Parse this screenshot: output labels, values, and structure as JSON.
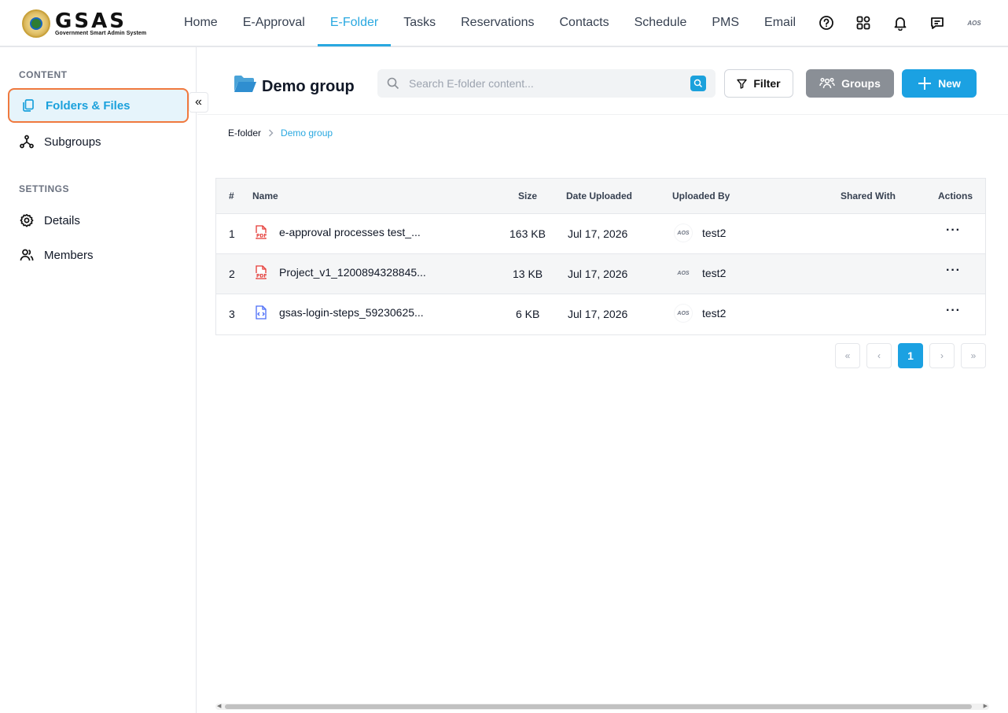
{
  "app": {
    "logo_title": "GSAS",
    "logo_subtitle": "Government Smart Admin System"
  },
  "nav": {
    "items": [
      {
        "label": "Home"
      },
      {
        "label": "E-Approval"
      },
      {
        "label": "E-Folder",
        "active": true
      },
      {
        "label": "Tasks"
      },
      {
        "label": "Reservations"
      },
      {
        "label": "Contacts"
      },
      {
        "label": "Schedule"
      },
      {
        "label": "PMS"
      },
      {
        "label": "Email"
      }
    ],
    "icons": [
      "help-icon",
      "apps-grid-icon",
      "bell-icon",
      "chat-icon",
      "user-avatar"
    ],
    "avatar_text": "AOS"
  },
  "sidebar": {
    "content_label": "CONTENT",
    "settings_label": "SETTINGS",
    "content_items": [
      {
        "label": "Folders & Files",
        "icon": "files-icon",
        "active": true
      },
      {
        "label": "Subgroups",
        "icon": "subgroups-icon"
      }
    ],
    "settings_items": [
      {
        "label": "Details",
        "icon": "gear-icon"
      },
      {
        "label": "Members",
        "icon": "members-icon"
      }
    ],
    "collapse_glyph": "«"
  },
  "header": {
    "group_title": "Demo group",
    "search_placeholder": "Search E-folder content...",
    "filter_label": "Filter",
    "groups_label": "Groups",
    "new_label": "New"
  },
  "breadcrumb": {
    "root": "E-folder",
    "current": "Demo group"
  },
  "table": {
    "columns": {
      "index": "#",
      "name": "Name",
      "size": "Size",
      "date": "Date Uploaded",
      "uploaded_by": "Uploaded By",
      "shared_with": "Shared With",
      "actions": "Actions"
    },
    "rows": [
      {
        "index": "1",
        "name": "e-approval processes test_...",
        "type": "pdf",
        "size": "163 KB",
        "date": "Jul 17, 2026",
        "uploaded_by": "test2",
        "avatar": "AOS",
        "shared_with": "",
        "actions": "···"
      },
      {
        "index": "2",
        "name": "Project_v1_1200894328845...",
        "type": "pdf",
        "size": "13 KB",
        "date": "Jul 17, 2026",
        "uploaded_by": "test2",
        "avatar": "AOS",
        "shared_with": "",
        "actions": "···"
      },
      {
        "index": "3",
        "name": "gsas-login-steps_59230625...",
        "type": "code",
        "size": "6 KB",
        "date": "Jul 17, 2026",
        "uploaded_by": "test2",
        "avatar": "AOS",
        "shared_with": "",
        "actions": "···"
      }
    ]
  },
  "pagination": {
    "first": "«",
    "prev": "‹",
    "current": "1",
    "next": "›",
    "last": "»"
  },
  "colors": {
    "accent": "#1ba1e2",
    "active_outline": "#f0793e",
    "groups_button": "#8a8f96",
    "pdf_red": "#e53935"
  }
}
